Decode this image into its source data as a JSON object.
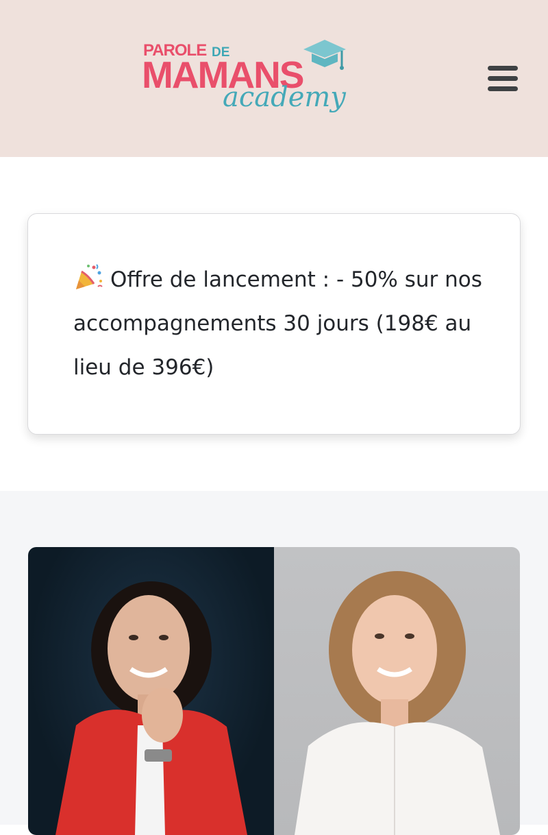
{
  "header": {
    "logo": {
      "line1": "PAROLE",
      "line1_de": "DE",
      "line2": "MAMANS",
      "line3": "academy"
    },
    "menu_icon": "hamburger-menu-icon"
  },
  "promo": {
    "icon": "party-popper-emoji",
    "text": "Offre de lancement : - 50% sur nos accompagnements 30 jours (198€ au lieu de 396€)"
  },
  "team": {
    "photos": [
      "woman-red-blazer-photo",
      "woman-white-blouse-photo"
    ]
  },
  "colors": {
    "header_bg": "#efe1dc",
    "brand_pink": "#e94f6b",
    "brand_teal": "#3fa7b5",
    "section_bg": "#f5f6f8",
    "text": "#23262b"
  }
}
